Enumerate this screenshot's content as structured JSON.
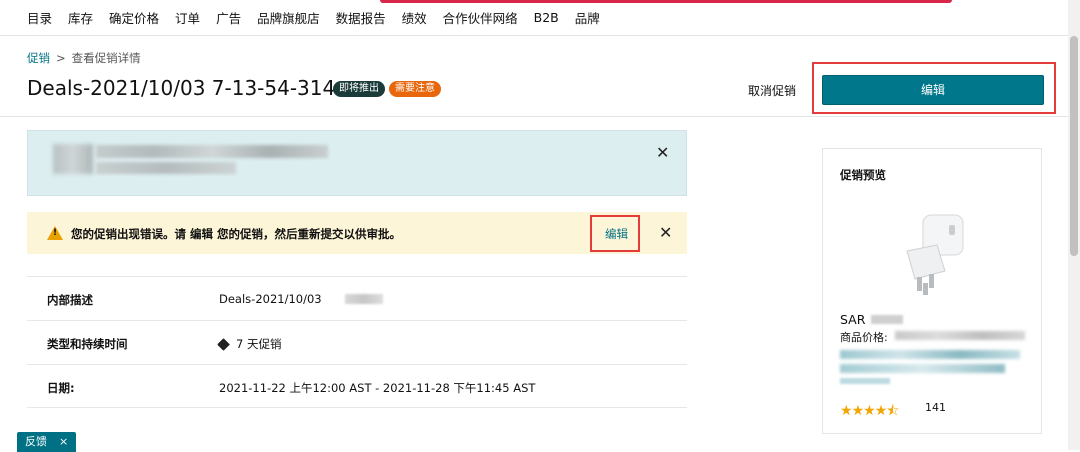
{
  "nav": {
    "items": [
      "目录",
      "库存",
      "确定价格",
      "订单",
      "广告",
      "品牌旗舰店",
      "数据报告",
      "绩效",
      "合作伙伴网络",
      "B2B",
      "品牌"
    ]
  },
  "breadcrumb": {
    "parent": "促销",
    "separator": ">",
    "current": "查看促销详情"
  },
  "header": {
    "title": "Deals-2021/10/03 7-13-54-314",
    "badge_status": "即将推出",
    "badge_attention": "需要注意",
    "cancel_label": "取消促销",
    "edit_label": "编辑"
  },
  "warning": {
    "text": "您的促销出现错误。请 编辑 您的促销，然后重新提交以供审批。",
    "edit_label": "编辑"
  },
  "details": [
    {
      "key": "内部描述",
      "value": "Deals-2021/10/03"
    },
    {
      "key": "类型和持续时间",
      "value": "7 天促销"
    },
    {
      "key": "日期:",
      "value": "2021-11-22 上午12:00 AST - 2021-11-28 下午11:45 AST"
    }
  ],
  "preview": {
    "title": "促销预览",
    "price_prefix": "SAR",
    "list_price_label": "商品价格:",
    "rating_count": "141",
    "rating": 4.5,
    "star_color": "#f0a500"
  },
  "feedback": {
    "label": "反馈",
    "close": "×"
  },
  "icons": {
    "close": "close-icon",
    "warning": "warning-triangle-icon",
    "tag": "tag-icon",
    "star": "star-icon"
  },
  "colors": {
    "primary": "#00778a",
    "link": "#007185",
    "warning_bg": "#fdf5d8",
    "info_bg": "#dceef0",
    "badge_dark": "#1b3a3a",
    "badge_orange": "#e8670c",
    "highlight": "#e63b3b"
  }
}
